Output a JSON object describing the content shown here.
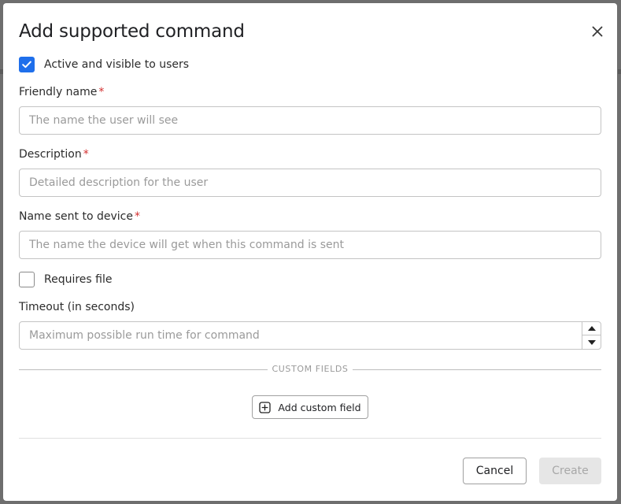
{
  "dialog": {
    "title": "Add supported command",
    "close_icon": "close-icon"
  },
  "active_checkbox": {
    "label": "Active and visible to users",
    "checked": true
  },
  "fields": {
    "friendly_name": {
      "label": "Friendly name",
      "required_mark": "*",
      "placeholder": "The name the user will see",
      "value": ""
    },
    "description": {
      "label": "Description",
      "required_mark": "*",
      "placeholder": "Detailed description for the user",
      "value": ""
    },
    "device_name": {
      "label": "Name sent to device",
      "required_mark": "*",
      "placeholder": "The name the device will get when this command is sent",
      "value": ""
    },
    "timeout": {
      "label": "Timeout (in seconds)",
      "placeholder": "Maximum possible run time for command",
      "value": ""
    }
  },
  "requires_file": {
    "label": "Requires file",
    "checked": false
  },
  "custom_fields": {
    "section_title": "CUSTOM FIELDS",
    "add_button_label": "Add custom field",
    "add_icon": "plus-square-icon"
  },
  "footer": {
    "cancel_label": "Cancel",
    "create_label": "Create"
  },
  "colors": {
    "accent": "#1f6feb",
    "required": "#d32f2f",
    "disabled_bg": "#e6e6e6"
  }
}
